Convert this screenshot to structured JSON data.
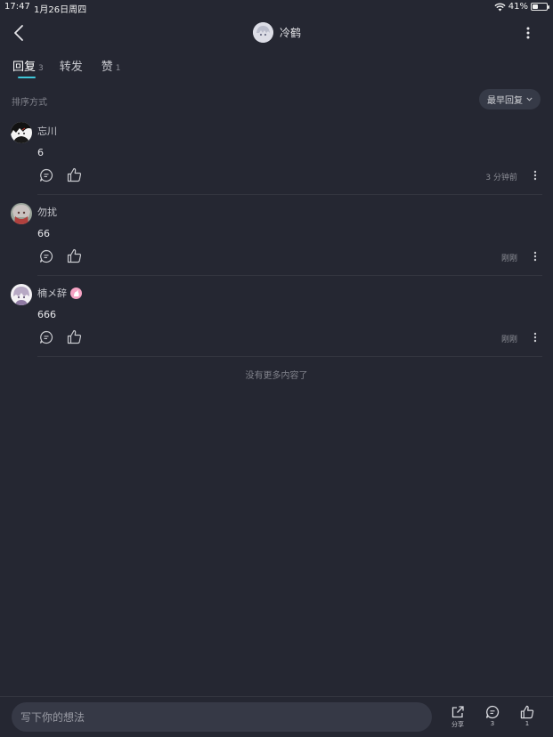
{
  "status": {
    "time": "17:47",
    "date": "1月26日周四",
    "battery": "41%",
    "battery_level": 0.41
  },
  "header": {
    "title": "冷鹤"
  },
  "tabs": [
    {
      "label": "回复",
      "count": "3"
    },
    {
      "label": "转发",
      "count": ""
    },
    {
      "label": "赞",
      "count": "1"
    }
  ],
  "sort": {
    "label": "排序方式",
    "value": "最早回复"
  },
  "comments": [
    {
      "name": "忘川",
      "text": "6",
      "time": "3 分钟前"
    },
    {
      "name": "勿扰",
      "text": "66",
      "time": "刚刚"
    },
    {
      "name": "楠メ辞",
      "text": "666",
      "time": "刚刚"
    }
  ],
  "footer_note": "没有更多内容了",
  "bottom": {
    "placeholder": "写下你的想法",
    "share_label": "分享",
    "comment_count": "3",
    "like_count": "1"
  },
  "colors": {
    "accent": "#3ec6d8",
    "background": "#252732"
  }
}
